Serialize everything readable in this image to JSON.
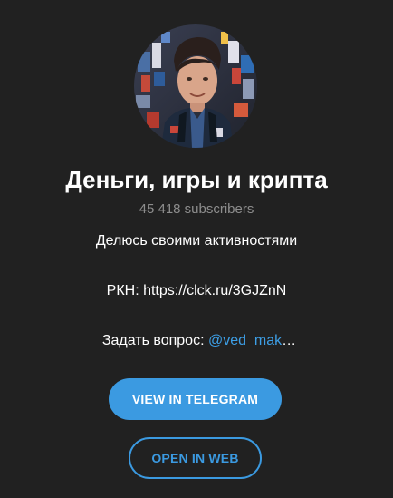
{
  "channel": {
    "title": "Деньги, игры и крипта",
    "subscribers": "45 418 subscribers",
    "avatar_icon": "channel-avatar-photo"
  },
  "description": {
    "line1": "Делюсь своими активностями",
    "line2": "РКН: https://clck.ru/3GJZnN",
    "line3_prefix": "Задать вопрос: ",
    "line3_mention": "@ved_mak",
    "line3_ellipsis": "…"
  },
  "buttons": {
    "view_in_telegram": "VIEW IN TELEGRAM",
    "open_in_web": "OPEN IN WEB"
  },
  "colors": {
    "background": "#212121",
    "accent": "#3b9ae1",
    "muted_text": "#8d8d8d"
  }
}
